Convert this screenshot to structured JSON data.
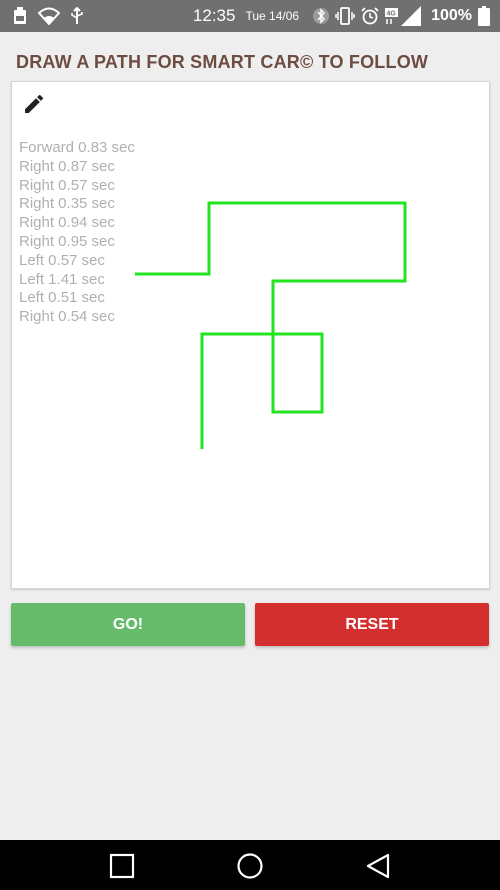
{
  "status_bar": {
    "time": "12:35",
    "date": "Tue 14/06",
    "battery": "100%",
    "network": "4G",
    "left_icons": [
      "battery-notification-icon",
      "wifi-icon",
      "usb-icon"
    ],
    "right_icons": [
      "bluetooth-icon",
      "vibrate-icon",
      "alarm-icon",
      "signal-icon"
    ]
  },
  "header": {
    "title": "DRAW A PATH FOR SMART CAR© TO FOLLOW"
  },
  "canvas": {
    "tool_icon": "pencil-icon",
    "path_color": "#22e51f",
    "steps": [
      "Forward 0.83 sec",
      "Right 0.87 sec",
      "Right 0.57 sec",
      "Right 0.35 sec",
      "Right 0.94 sec",
      "Right 0.95 sec",
      "Left 0.57 sec",
      "Left 1.41 sec",
      "Left 0.51 sec",
      "Right 0.54 sec"
    ]
  },
  "actions": {
    "go_label": "GO!",
    "reset_label": "RESET",
    "go_color": "#66bb6a",
    "reset_color": "#d32f2f"
  },
  "nav_bar": {
    "buttons": [
      "recents-icon",
      "home-icon",
      "back-icon"
    ]
  }
}
